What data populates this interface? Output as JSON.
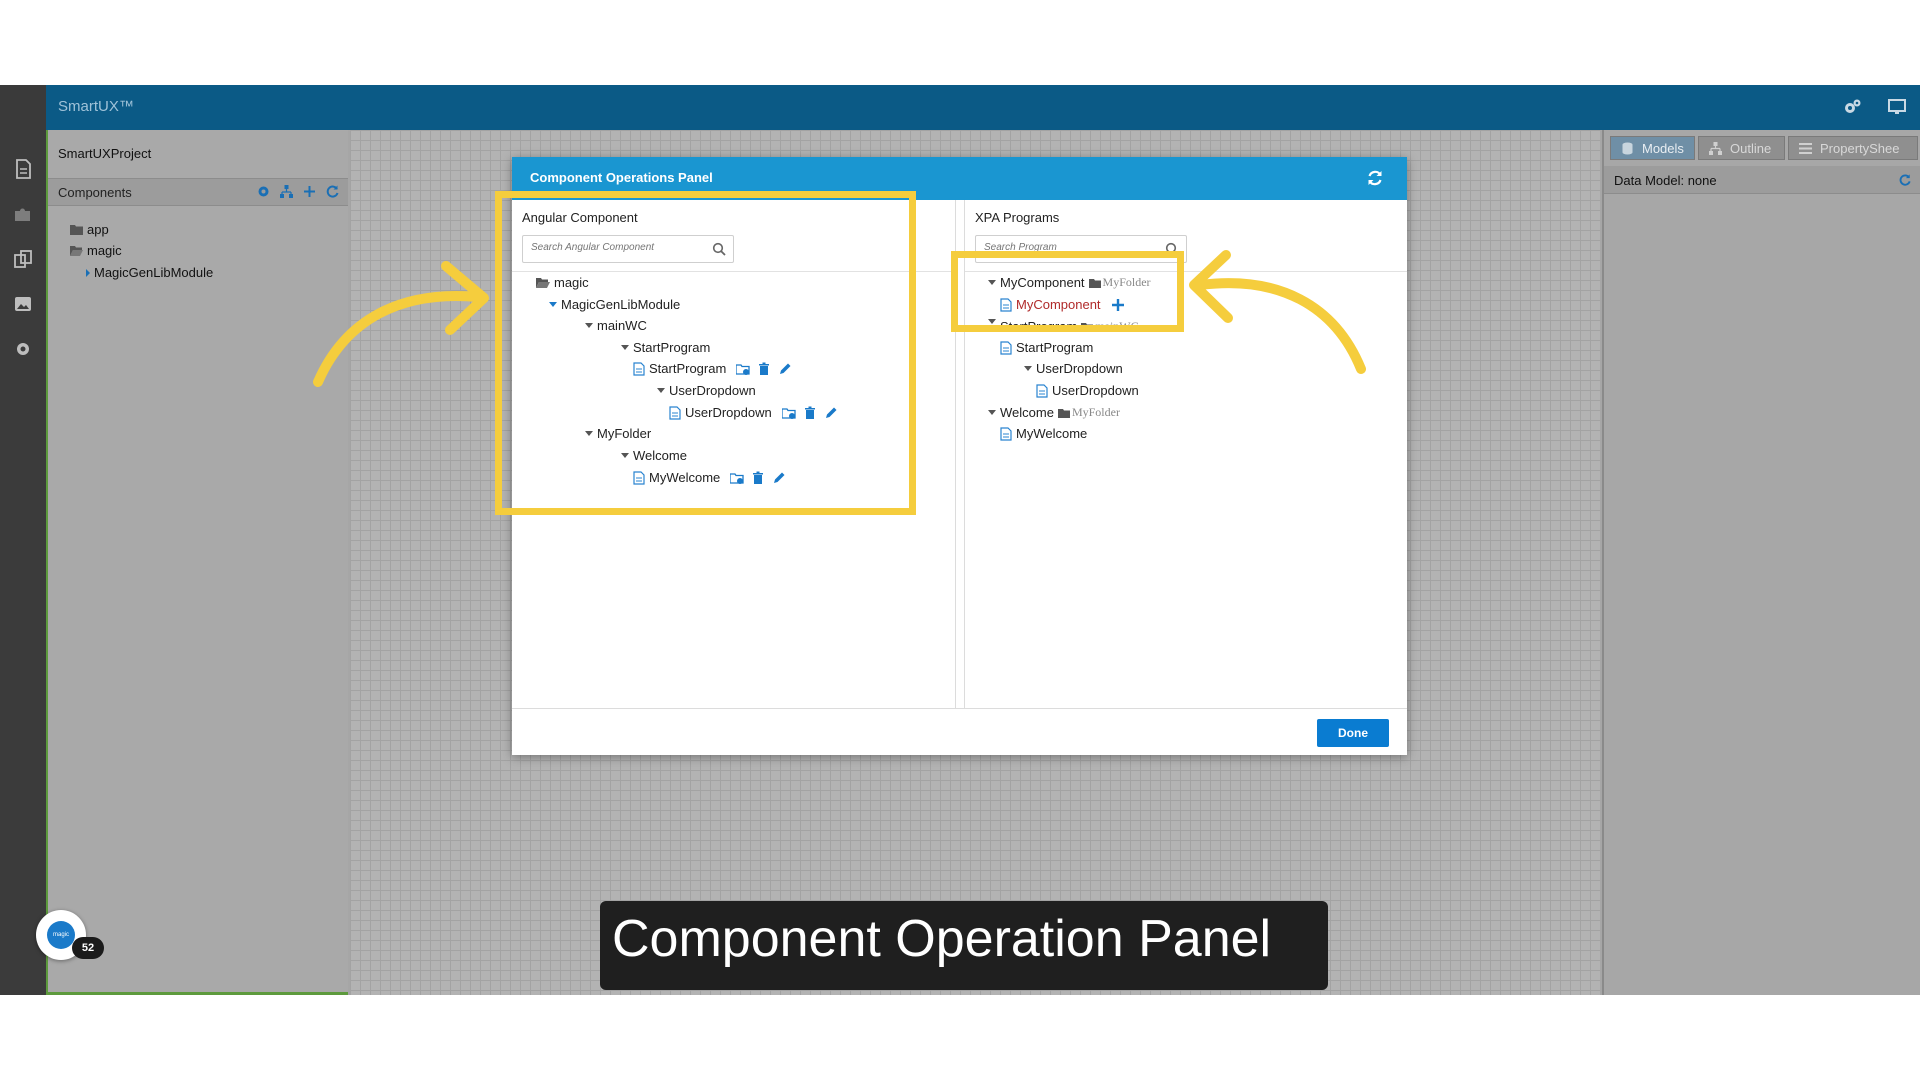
{
  "app": {
    "brand": "SmartUX™"
  },
  "left_panel": {
    "project": "SmartUXProject",
    "components_title": "Components",
    "tree": [
      "app",
      "magic",
      "MagicGenLibModule"
    ]
  },
  "right_panel": {
    "tabs": [
      "Models",
      "Outline",
      "PropertyShee"
    ],
    "data_model": "Data Model: none"
  },
  "dialog": {
    "title": "Component Operations Panel",
    "left": {
      "title": "Angular Component",
      "search_placeholder": "Search Angular Component",
      "tree": {
        "magic": "magic",
        "module": "MagicGenLibModule",
        "mainwc": "mainWC",
        "start_folder": "StartProgram",
        "start_comp": "StartProgram",
        "user_folder": "UserDropdown",
        "user_comp": "UserDropdown",
        "myfolder": "MyFolder",
        "welcome_folder": "Welcome",
        "welcome_comp": "MyWelcome"
      }
    },
    "right": {
      "title": "XPA Programs",
      "search_placeholder": "Search Program",
      "tree": {
        "mycomp_parent": "MyComponent",
        "mycomp_folder": "MyFolder",
        "mycomp_child": "MyComponent",
        "start_parent": "StartProgram",
        "start_folder_note": "mainWC",
        "start_child": "StartProgram",
        "user_parent": "UserDropdown",
        "user_child": "UserDropdown",
        "welcome_parent": "Welcome",
        "welcome_folder": "MyFolder",
        "welcome_child": "MyWelcome"
      }
    },
    "done_label": "Done"
  },
  "caption": "Component Operation Panel",
  "avatar": {
    "logo_text": "magic",
    "badge": "52"
  },
  "colors": {
    "header": "#0b5a86",
    "dialog_header": "#1a96d1",
    "highlight": "#f5cd3d",
    "done_button": "#0a7cd1"
  }
}
